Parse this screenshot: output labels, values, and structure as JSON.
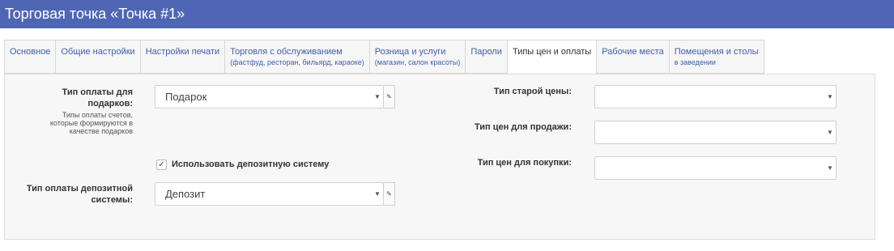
{
  "header": {
    "title": "Торговая точка «Точка #1»"
  },
  "tabs": [
    {
      "label": "Основное",
      "sub": ""
    },
    {
      "label": "Общие настройки",
      "sub": ""
    },
    {
      "label": "Настройки печати",
      "sub": ""
    },
    {
      "label": "Торговля с обслуживанием",
      "sub": "(фастфуд, ресторан, бильярд, караоке)"
    },
    {
      "label": "Розница и услуги",
      "sub": "(магазин, салон красоты)"
    },
    {
      "label": "Пароли",
      "sub": ""
    },
    {
      "label": "Типы цен и оплаты",
      "sub": ""
    },
    {
      "label": "Рабочие места",
      "sub": ""
    },
    {
      "label": "Помещения и столы",
      "sub": "в заведении"
    }
  ],
  "form": {
    "gift_payment": {
      "label_line1": "Тип оплаты для",
      "label_line2": "подарков:",
      "hint": [
        "Типы оплаты счетов,",
        "которые формируются в",
        "качестве подарков"
      ],
      "value": "Подарок"
    },
    "deposit_checkbox": {
      "label": "Использовать депозитную систему",
      "checked": true
    },
    "deposit_payment": {
      "label_line1": "Тип оплаты депозитной",
      "label_line2": "системы:",
      "value": "Депозит"
    },
    "old_price_type": {
      "label": "Тип старой цены:",
      "value": ""
    },
    "sale_price_type": {
      "label": "Тип цен для продажи:",
      "value": ""
    },
    "purchase_price_type": {
      "label": "Тип цен для покупки:",
      "value": ""
    }
  },
  "icons": {
    "dropdown": "chevron-down-icon",
    "edit": "edit-icon",
    "check": "check-icon"
  },
  "colors": {
    "header_bg": "#4f66b5",
    "tab_link": "#3f5ea8",
    "panel_bg": "#f7f7f7"
  }
}
